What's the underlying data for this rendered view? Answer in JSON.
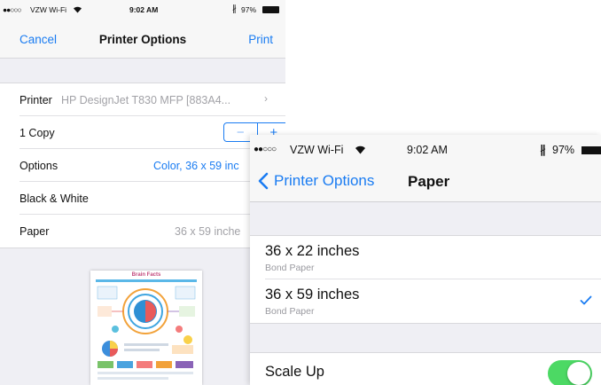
{
  "back_screen": {
    "status": {
      "carrier": "VZW Wi-Fi",
      "time": "9:02 AM",
      "battery": "97%"
    },
    "nav": {
      "cancel": "Cancel",
      "title": "Printer Options",
      "print": "Print"
    },
    "rows": {
      "printer_label": "Printer",
      "printer_value": "HP DesignJet T830 MFP [883A4...",
      "copies": "1 Copy",
      "stepper_minus": "−",
      "stepper_plus": "+",
      "options_label": "Options",
      "options_value": "Color, 36 x 59 inc",
      "bw_label": "Black & White",
      "bw_on": false,
      "paper_label": "Paper",
      "paper_value": "36 x 59 inche"
    },
    "preview_title": "Brain Facts"
  },
  "front_screen": {
    "status": {
      "carrier": "VZW Wi-Fi",
      "time": "9:02 AM",
      "battery": "97%"
    },
    "nav": {
      "back": "Printer Options",
      "title": "Paper"
    },
    "papers": [
      {
        "size": "36 x 22 inches",
        "type": "Bond Paper",
        "selected": false
      },
      {
        "size": "36 x 59 inches",
        "type": "Bond Paper",
        "selected": true
      }
    ],
    "scale_up_label": "Scale Up",
    "scale_up_on": true
  },
  "colors": {
    "ios_blue": "#1a7cf2",
    "switch_green": "#4cd964",
    "group_bg": "#efeff4"
  }
}
